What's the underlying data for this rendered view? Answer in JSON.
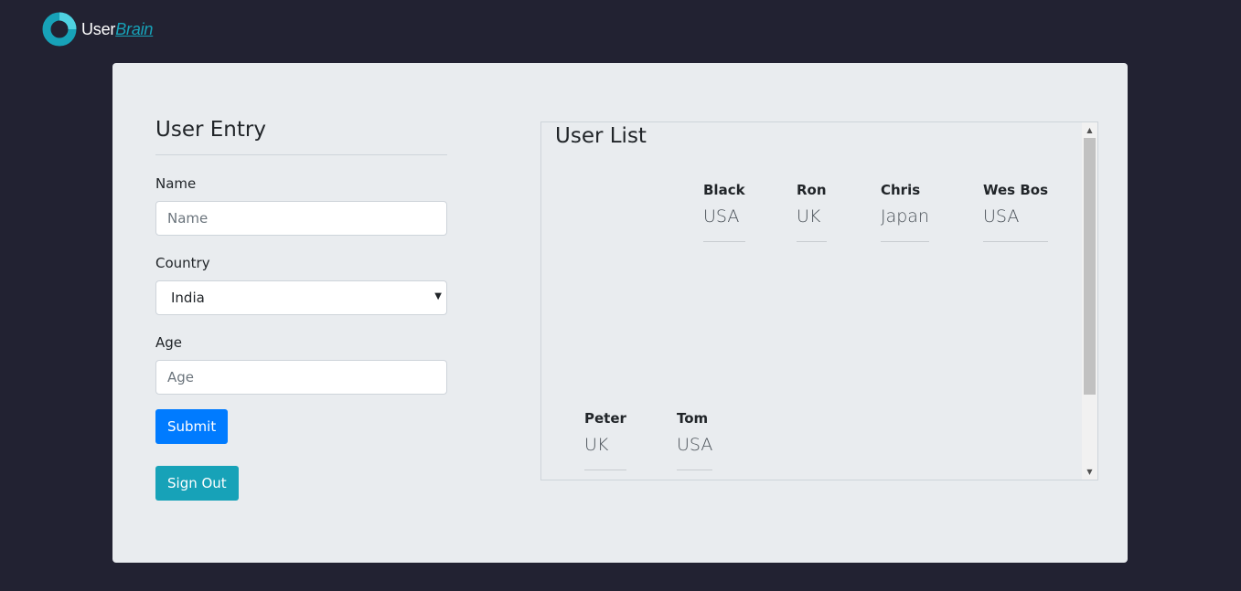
{
  "header": {
    "logo_user": "User",
    "logo_brain": "Brain"
  },
  "entry": {
    "title": "User Entry",
    "name_label": "Name",
    "name_placeholder": "Name",
    "country_label": "Country",
    "country_selected": "India",
    "age_label": "Age",
    "age_placeholder": "Age",
    "submit_label": "Submit",
    "signout_label": "Sign Out"
  },
  "user_list": {
    "title": "User List",
    "users": [
      {
        "name": "Black",
        "country": "USA"
      },
      {
        "name": "Ron",
        "country": "UK"
      },
      {
        "name": "Chris",
        "country": "Japan"
      },
      {
        "name": "Wes Bos",
        "country": "USA"
      },
      {
        "name": "Peter",
        "country": "UK"
      },
      {
        "name": "Tom",
        "country": "USA"
      }
    ]
  },
  "colors": {
    "background": "#222232",
    "panel": "#e9ecef",
    "primary": "#007bff",
    "info": "#17a2b8"
  }
}
